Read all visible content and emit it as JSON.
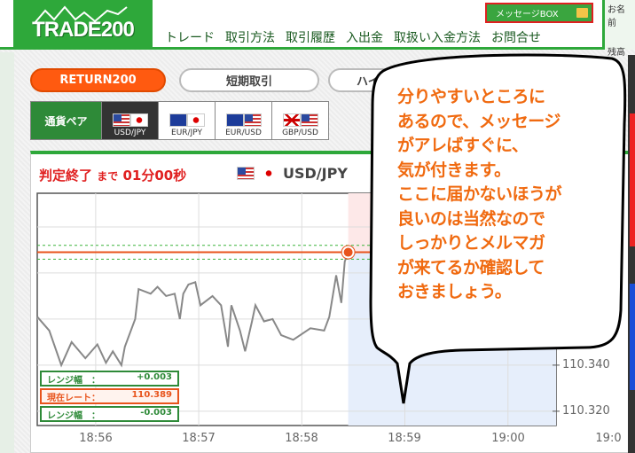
{
  "header": {
    "logo": "TRADE200",
    "nav": [
      "トレード",
      "取引方法",
      "取引履歴",
      "入出金",
      "取扱い入金方法",
      "お問合せ"
    ],
    "message_box": "メッセージBOX",
    "user_name_label": "お名前",
    "balance_label": "残高"
  },
  "tabs": [
    "RETURN200",
    "短期取引",
    "ハイ"
  ],
  "pairs": {
    "label": "通貨ペア",
    "items": [
      {
        "label": "USD/JPY",
        "selected": true
      },
      {
        "label": "EUR/JPY"
      },
      {
        "label": "EUR/USD"
      },
      {
        "label": "GBP/USD"
      }
    ]
  },
  "status": {
    "prefix": "判定終了",
    "mid": "まで",
    "time": "01分00秒",
    "pair": "USD/JPY"
  },
  "info": {
    "upper_label": "レンジ幅　：",
    "upper_value": "+0.003",
    "current_label": "現在レート：",
    "current_value": "110.389",
    "lower_label": "レンジ幅　：",
    "lower_value": "-0.003"
  },
  "colors": {
    "brand_green": "#2ea83a",
    "accent_orange": "#ff5a10",
    "rate_line": "#e8541c",
    "range_dash": "#3bb33b",
    "up_zone": "#fde8e8",
    "down_zone": "#e6eefb"
  },
  "chart_data": {
    "type": "line",
    "x_ticks": [
      "18:56",
      "18:57",
      "18:58",
      "18:59",
      "19:00",
      "19:0"
    ],
    "y_ticks": [
      "110.340",
      "110.320"
    ],
    "xlim": [
      "18:55:26",
      "19:00:28"
    ],
    "ylim": [
      110.3138,
      110.4146
    ],
    "current_rate": 110.389,
    "range": 0.003,
    "judgment_time": "18:58:27",
    "points": [
      [
        "18:55:26",
        110.361
      ],
      [
        "18:55:33",
        110.355
      ],
      [
        "18:55:40",
        110.34
      ],
      [
        "18:55:46",
        110.35
      ],
      [
        "18:55:54",
        110.343
      ],
      [
        "18:56:01",
        110.349
      ],
      [
        "18:56:06",
        110.341
      ],
      [
        "18:56:10",
        110.346
      ],
      [
        "18:56:15",
        110.34
      ],
      [
        "18:56:17",
        110.348
      ],
      [
        "18:56:23",
        110.36
      ],
      [
        "18:56:25",
        110.373
      ],
      [
        "18:56:32",
        110.371
      ],
      [
        "18:56:36",
        110.374
      ],
      [
        "18:56:41",
        110.37
      ],
      [
        "18:56:46",
        110.371
      ],
      [
        "18:56:49",
        110.36
      ],
      [
        "18:56:51",
        110.371
      ],
      [
        "18:56:54",
        110.375
      ],
      [
        "18:56:58",
        110.376
      ],
      [
        "18:57:01",
        110.366
      ],
      [
        "18:57:08",
        110.37
      ],
      [
        "18:57:13",
        110.366
      ],
      [
        "18:57:17",
        110.348
      ],
      [
        "18:57:19",
        110.366
      ],
      [
        "18:57:24",
        110.355
      ],
      [
        "18:57:27",
        110.346
      ],
      [
        "18:57:31",
        110.359
      ],
      [
        "18:57:33",
        110.366
      ],
      [
        "18:57:38",
        110.359
      ],
      [
        "18:57:43",
        110.36
      ],
      [
        "18:57:48",
        110.353
      ],
      [
        "18:57:55",
        110.351
      ],
      [
        "18:58:05",
        110.356
      ],
      [
        "18:58:13",
        110.355
      ],
      [
        "18:58:16",
        110.361
      ],
      [
        "18:58:20",
        110.379
      ],
      [
        "18:58:23",
        110.367
      ],
      [
        "18:58:25",
        110.385
      ],
      [
        "18:58:27",
        110.389
      ]
    ]
  },
  "callout": [
    "分りやすいところに",
    "あるので、メッセージ",
    "がアレばすぐに、",
    "気が付きます。",
    "ここに届かないほうが",
    "良いのは当然なので",
    "しっかりとメルマガ",
    "が来てるか確認して",
    "おきましょう。"
  ]
}
